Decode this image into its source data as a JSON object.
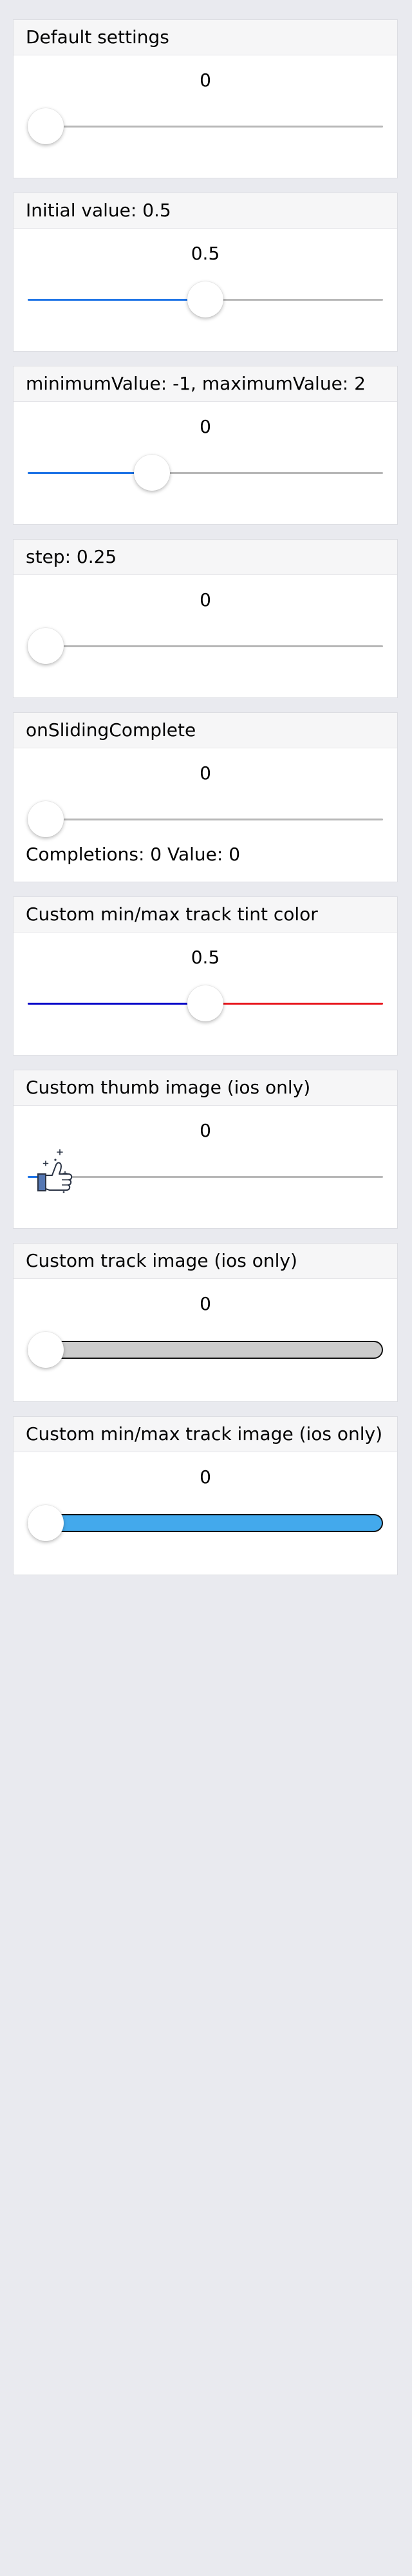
{
  "cards": [
    {
      "title": "Default settings",
      "value": "0",
      "position": 0
    },
    {
      "title": "Initial value: 0.5",
      "value": "0.5",
      "position": 0.5
    },
    {
      "title": "minimumValue: -1, maximumValue: 2",
      "value": "0",
      "position": 0.333
    },
    {
      "title": "step: 0.25",
      "value": "0",
      "position": 0
    },
    {
      "title": "onSlidingComplete",
      "value": "0",
      "position": 0,
      "completions_text": "Completions: 0 Value: 0"
    },
    {
      "title": "Custom min/max track tint color",
      "value": "0.5",
      "position": 0.5
    },
    {
      "title": "Custom thumb image (ios only)",
      "value": "0",
      "position": 0
    },
    {
      "title": "Custom track image (ios only)",
      "value": "0",
      "position": 0
    },
    {
      "title": "Custom min/max track image (ios only)",
      "value": "0",
      "position": 0
    }
  ],
  "colors": {
    "background": "#e9eaef",
    "min_track_default": "#1f74e6",
    "max_track_default": "#b7b7b7",
    "custom_min_track": "#0000c8",
    "custom_max_track": "#e8141b",
    "track_image_fill": "#cccccc",
    "min_max_track_image_fill": "#43a9ec"
  },
  "icons": {
    "custom_thumb": "thumbs-up-icon"
  }
}
